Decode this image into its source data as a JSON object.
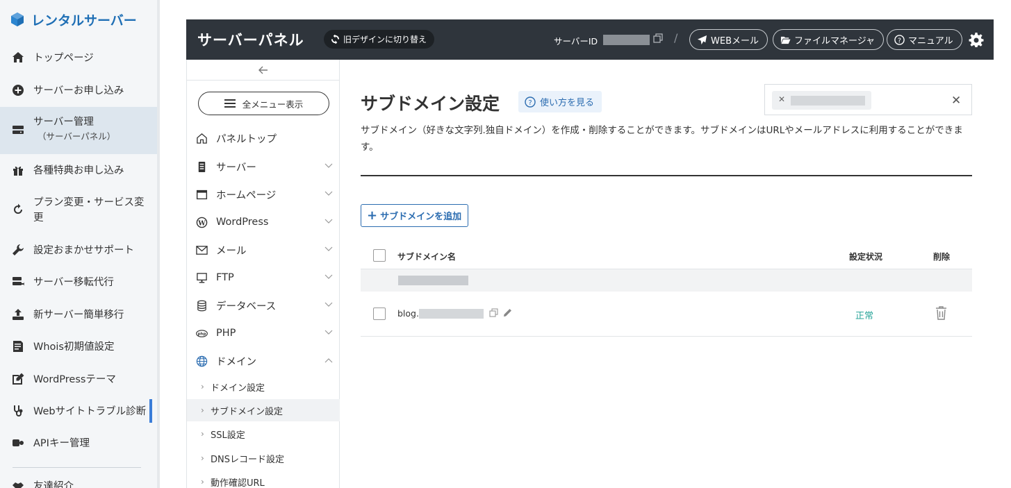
{
  "sidebar": {
    "brand": "レンタルサーバー",
    "items": [
      {
        "label": "トップページ",
        "icon": "home-icon"
      },
      {
        "label": "サーバーお申し込み",
        "icon": "plus-circle-icon"
      },
      {
        "label": "サーバー管理",
        "sub": "（サーバーパネル）",
        "icon": "server-drive-icon",
        "active": true
      },
      {
        "label": "各種特典お申し込み",
        "icon": "gift-icon"
      },
      {
        "label": "プラン変更・サービス変更",
        "icon": "refresh-icon"
      },
      {
        "label": "設定おまかせサポート",
        "icon": "wrench-icon"
      },
      {
        "label": "サーバー移転代行",
        "icon": "server-move-icon"
      },
      {
        "label": "新サーバー簡単移行",
        "icon": "upload-icon"
      },
      {
        "label": "Whois初期値設定",
        "icon": "document-list-icon"
      },
      {
        "label": "WordPressテーマ",
        "icon": "edit-square-icon"
      },
      {
        "label": "Webサイトトラブル診断",
        "icon": "stethoscope-icon"
      },
      {
        "label": "APIキー管理",
        "icon": "api-key-icon"
      },
      {
        "label": "友達紹介",
        "icon": "handshake-icon"
      }
    ]
  },
  "topbar": {
    "title": "サーバーパネル",
    "switch_label": "旧デザインに切り替え",
    "server_id_label": "サーバーID",
    "webmail_label": "WEBメール",
    "filemanager_label": "ファイルマネージャ",
    "manual_label": "マニュアル"
  },
  "midnav": {
    "all_menu_label": "全メニュー表示",
    "items": [
      {
        "label": "パネルトップ",
        "icon": "home-outline-icon"
      },
      {
        "label": "サーバー",
        "icon": "server-icon"
      },
      {
        "label": "ホームページ",
        "icon": "browser-window-icon"
      },
      {
        "label": "WordPress",
        "icon": "wordpress-icon"
      },
      {
        "label": "メール",
        "icon": "envelope-icon"
      },
      {
        "label": "FTP",
        "icon": "monitor-icon"
      },
      {
        "label": "データベース",
        "icon": "database-icon"
      },
      {
        "label": "PHP",
        "icon": "php-icon"
      },
      {
        "label": "ドメイン",
        "icon": "globe-icon"
      }
    ],
    "domain_sub": [
      {
        "label": "ドメイン設定"
      },
      {
        "label": "サブドメイン設定",
        "active": true
      },
      {
        "label": "SSL設定"
      },
      {
        "label": "DNSレコード設定"
      },
      {
        "label": "動作確認URL"
      }
    ]
  },
  "main": {
    "title": "サブドメイン設定",
    "howto_label": "使い方を見る",
    "description": "サブドメイン（好きな文字列.独自ドメイン）を作成・削除することができます。サブドメインはURLやメールアドレスに利用することができます。",
    "add_button_label": "サブドメインを追加",
    "table": {
      "col_name": "サブドメイン名",
      "col_status": "設定状況",
      "col_delete": "削除",
      "rows": [
        {
          "name_prefix": "blog.",
          "status": "正常"
        }
      ]
    }
  },
  "colors": {
    "accent": "#2b6cb0",
    "brand": "#1f6fb5",
    "topbar_bg": "#2f353c",
    "status_ok": "#2aa59a",
    "active_marker": "#3b7dd8"
  }
}
